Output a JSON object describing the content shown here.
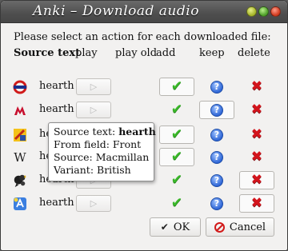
{
  "window": {
    "title": "Anki – Download audio"
  },
  "instruction": "Please select an action for each downloaded file:",
  "headers": {
    "source_text": "Source text",
    "play": "play",
    "play_old": "play old",
    "add": "add",
    "keep": "keep",
    "delete": "delete"
  },
  "rows": [
    {
      "source_icon": "london-underground-icon",
      "word": "hearth",
      "play_glyph": "▷",
      "selected": "add"
    },
    {
      "source_icon": "macmillan-icon",
      "word": "hearth",
      "play_glyph": "▷",
      "selected": "keep"
    },
    {
      "source_icon": "leo-dictionary-icon",
      "word": "hearth",
      "play_glyph": "▷",
      "selected": "add"
    },
    {
      "source_icon": "wikipedia-icon",
      "word": "hearth",
      "play_glyph": "▷",
      "selected": "add"
    },
    {
      "source_icon": "forvo-icon",
      "word": "hearth",
      "play_glyph": "▷",
      "selected": "delete"
    },
    {
      "source_icon": "app-store-icon",
      "word": "hearth",
      "play_glyph": "▷",
      "selected": "delete"
    }
  ],
  "tooltip": {
    "source_text_label": "Source text:",
    "source_text_value": "hearth",
    "from_field": "From field: Front",
    "source": "Source: Macmillan",
    "variant": "Variant: British"
  },
  "buttons": {
    "ok_label": "OK",
    "ok_glyph": "✔",
    "cancel_label": "Cancel"
  },
  "colors": {
    "titlebar": "#555555",
    "check": "#3bb82a",
    "help": "#2f66d6",
    "delete": "#d4141c"
  }
}
